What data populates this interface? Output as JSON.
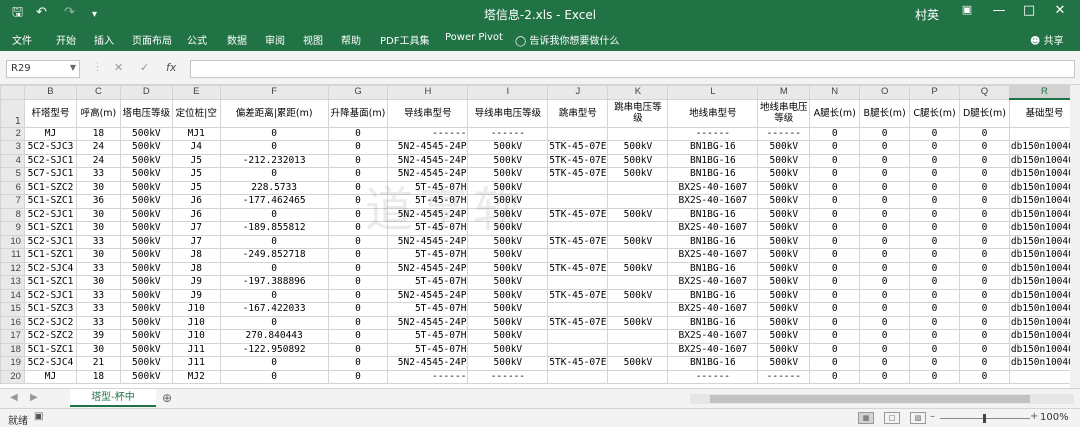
{
  "window": {
    "title": "塔信息-2.xls  -  Excel",
    "user": "村英",
    "accent": "#217346"
  },
  "quick_access": [
    "save-icon",
    "undo-icon",
    "redo-icon",
    "customize-icon"
  ],
  "ribbon": {
    "tabs": [
      "文件",
      "开始",
      "插入",
      "页面布局",
      "公式",
      "数据",
      "审阅",
      "视图",
      "帮助",
      "PDF工具集",
      "Power Pivot",
      "告诉我你想要做什么"
    ],
    "share": "共享"
  },
  "formula_bar": {
    "name_box": "R29",
    "cancel": "✕",
    "enter": "✓",
    "fx": "fx",
    "value": ""
  },
  "sheet": {
    "col_headers": [
      "B",
      "C",
      "D",
      "E",
      "F",
      "G",
      "H",
      "I",
      "J",
      "K",
      "L",
      "M",
      "N",
      "O",
      "P",
      "Q",
      "R"
    ],
    "selected_col": "R",
    "header_row": [
      "杆塔型号",
      "呼高(m)",
      "塔电压等级",
      "定位桩|空",
      "偏差距离|累距(m)",
      "升降基面(m)",
      "导线串型号",
      "导线串电压等级",
      "跳串型号",
      "跳串电压等级",
      "地线串型号",
      "地线串电压等级",
      "A腿长(m)",
      "B腿长(m)",
      "C腿长(m)",
      "D腿长(m)",
      "基础型号"
    ],
    "rows": [
      [
        "2",
        "MJ",
        "18",
        "500kV",
        "MJ1",
        "0",
        "0",
        "------",
        "------",
        "",
        "",
        "------",
        "------",
        "0",
        "0",
        "0",
        "0",
        ""
      ],
      [
        "3",
        "5C2-SJC3",
        "24",
        "500kV",
        "J4",
        "0",
        "0",
        "5N2-4545-24P",
        "500kV",
        "5TK-45-07E",
        "500kV",
        "BN1BG-16",
        "500kV",
        "0",
        "0",
        "0",
        "0",
        "db150n10040"
      ],
      [
        "4",
        "5C2-SJC1",
        "24",
        "500kV",
        "J5",
        "-212.232013",
        "0",
        "5N2-4545-24P",
        "500kV",
        "5TK-45-07E",
        "500kV",
        "BN1BG-16",
        "500kV",
        "0",
        "0",
        "0",
        "0",
        "db150n10040"
      ],
      [
        "5",
        "5C7-SJC1",
        "33",
        "500kV",
        "J5",
        "0",
        "0",
        "5N2-4545-24P",
        "500kV",
        "5TK-45-07E",
        "500kV",
        "BN1BG-16",
        "500kV",
        "0",
        "0",
        "0",
        "0",
        "db150n10040"
      ],
      [
        "6",
        "5C1-SZC2",
        "30",
        "500kV",
        "J5",
        "228.5733",
        "0",
        "5T-45-07H",
        "500kV",
        "",
        "",
        "BX2S-40-1607",
        "500kV",
        "0",
        "0",
        "0",
        "0",
        "db150n10040"
      ],
      [
        "7",
        "5C1-SZC1",
        "36",
        "500kV",
        "J6",
        "-177.462465",
        "0",
        "5T-45-07H",
        "500kV",
        "",
        "",
        "BX2S-40-1607",
        "500kV",
        "0",
        "0",
        "0",
        "0",
        "db150n10040"
      ],
      [
        "8",
        "5C2-SJC1",
        "30",
        "500kV",
        "J6",
        "0",
        "0",
        "5N2-4545-24P",
        "500kV",
        "5TK-45-07E",
        "500kV",
        "BN1BG-16",
        "500kV",
        "0",
        "0",
        "0",
        "0",
        "db150n10040"
      ],
      [
        "9",
        "5C1-SZC1",
        "30",
        "500kV",
        "J7",
        "-189.855812",
        "0",
        "5T-45-07H",
        "500kV",
        "",
        "",
        "BX2S-40-1607",
        "500kV",
        "0",
        "0",
        "0",
        "0",
        "db150n10040"
      ],
      [
        "10",
        "5C2-SJC1",
        "33",
        "500kV",
        "J7",
        "0",
        "0",
        "5N2-4545-24P",
        "500kV",
        "5TK-45-07E",
        "500kV",
        "BN1BG-16",
        "500kV",
        "0",
        "0",
        "0",
        "0",
        "db150n10040"
      ],
      [
        "11",
        "5C1-SZC1",
        "30",
        "500kV",
        "J8",
        "-249.852718",
        "0",
        "5T-45-07H",
        "500kV",
        "",
        "",
        "BX2S-40-1607",
        "500kV",
        "0",
        "0",
        "0",
        "0",
        "db150n10040"
      ],
      [
        "12",
        "5C2-SJC4",
        "33",
        "500kV",
        "J8",
        "0",
        "0",
        "5N2-4545-24P",
        "500kV",
        "5TK-45-07E",
        "500kV",
        "BN1BG-16",
        "500kV",
        "0",
        "0",
        "0",
        "0",
        "db150n10040"
      ],
      [
        "13",
        "5C1-SZC1",
        "30",
        "500kV",
        "J9",
        "-197.388896",
        "0",
        "5T-45-07H",
        "500kV",
        "",
        "",
        "BX2S-40-1607",
        "500kV",
        "0",
        "0",
        "0",
        "0",
        "db150n10040"
      ],
      [
        "14",
        "5C2-SJC1",
        "33",
        "500kV",
        "J9",
        "0",
        "0",
        "5N2-4545-24P",
        "500kV",
        "5TK-45-07E",
        "500kV",
        "BN1BG-16",
        "500kV",
        "0",
        "0",
        "0",
        "0",
        "db150n10040"
      ],
      [
        "15",
        "5C1-SZC3",
        "33",
        "500kV",
        "J10",
        "-167.422033",
        "0",
        "5T-45-07H",
        "500kV",
        "",
        "",
        "BX2S-40-1607",
        "500kV",
        "0",
        "0",
        "0",
        "0",
        "db150n10040"
      ],
      [
        "16",
        "5C2-SJC2",
        "33",
        "500kV",
        "J10",
        "0",
        "0",
        "5N2-4545-24P",
        "500kV",
        "5TK-45-07E",
        "500kV",
        "BN1BG-16",
        "500kV",
        "0",
        "0",
        "0",
        "0",
        "db150n10040"
      ],
      [
        "17",
        "5C2-SZC2",
        "39",
        "500kV",
        "J10",
        "270.840443",
        "0",
        "5T-45-07H",
        "500kV",
        "",
        "",
        "BX2S-40-1607",
        "500kV",
        "0",
        "0",
        "0",
        "0",
        "db150n10040"
      ],
      [
        "18",
        "5C1-SZC1",
        "30",
        "500kV",
        "J11",
        "-122.950892",
        "0",
        "5T-45-07H",
        "500kV",
        "",
        "",
        "BX2S-40-1607",
        "500kV",
        "0",
        "0",
        "0",
        "0",
        "db150n10040"
      ],
      [
        "19",
        "5C2-SJC4",
        "21",
        "500kV",
        "J11",
        "0",
        "0",
        "5N2-4545-24P",
        "500kV",
        "5TK-45-07E",
        "500kV",
        "BN1BG-16",
        "500kV",
        "0",
        "0",
        "0",
        "0",
        "db150n10040"
      ],
      [
        "20",
        "MJ",
        "18",
        "500kV",
        "MJ2",
        "0",
        "0",
        "------",
        "------",
        "",
        "",
        "------",
        "------",
        "0",
        "0",
        "0",
        "0",
        ""
      ]
    ]
  },
  "sheet_tabs": {
    "active": "塔型-杯中",
    "add": "⊕"
  },
  "watermark": "道亨软",
  "status": {
    "ready": "就绪",
    "zoom": "100%"
  }
}
